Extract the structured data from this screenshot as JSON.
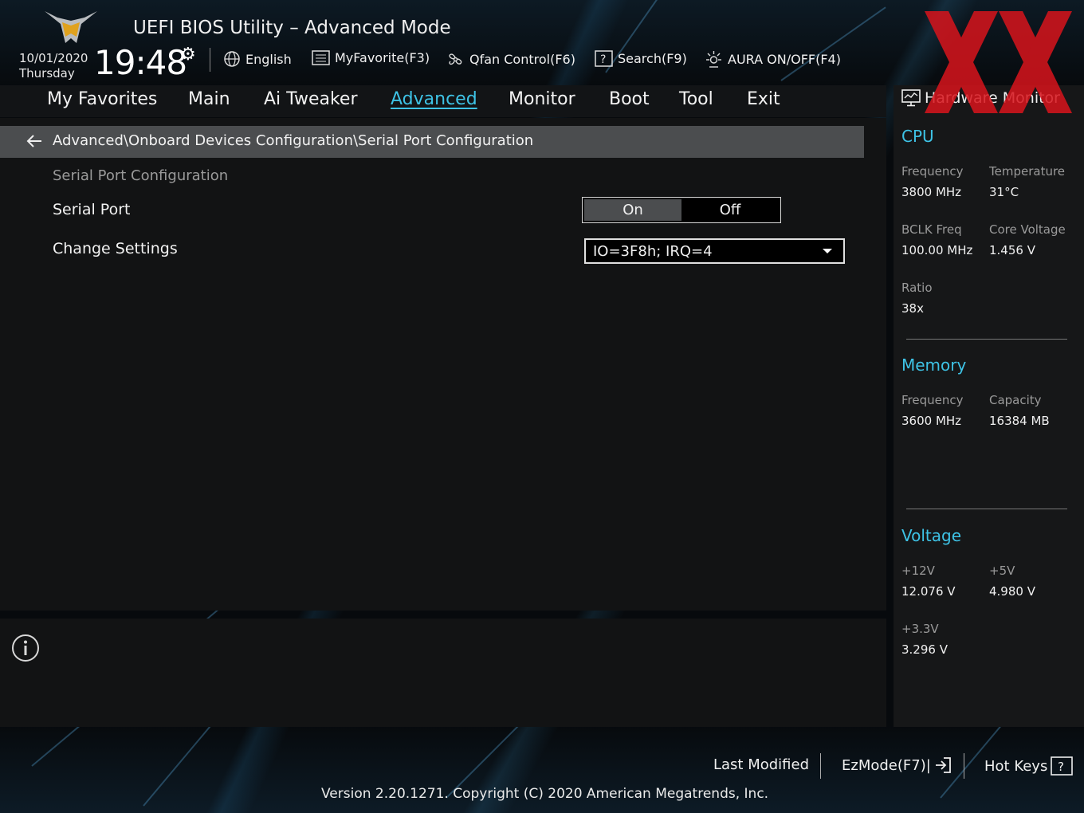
{
  "header": {
    "title": "UEFI BIOS Utility – Advanced Mode",
    "date": "10/01/2020",
    "day": "Thursday",
    "time": "19:48",
    "tools": {
      "language": "English",
      "favorite": "MyFavorite(F3)",
      "qfan": "Qfan Control(F6)",
      "search": "Search(F9)",
      "aura": "AURA ON/OFF(F4)"
    }
  },
  "nav": {
    "favorites": "My Favorites",
    "main": "Main",
    "ai_tweaker": "Ai Tweaker",
    "advanced": "Advanced",
    "monitor": "Monitor",
    "boot": "Boot",
    "tool": "Tool",
    "exit": "Exit",
    "active": "advanced"
  },
  "content": {
    "breadcrumb": "Advanced\\Onboard Devices Configuration\\Serial Port Configuration",
    "section_title": "Serial Port Configuration",
    "serial_port": {
      "label": "Serial Port",
      "on": "On",
      "off": "Off",
      "selected": "On"
    },
    "change_settings": {
      "label": "Change Settings",
      "value": "IO=3F8h; IRQ=4"
    }
  },
  "hardware_monitor": {
    "title": "Hardware Monitor",
    "cpu": {
      "title": "CPU",
      "frequency_label": "Frequency",
      "frequency": "3800 MHz",
      "temperature_label": "Temperature",
      "temperature": "31°C",
      "bclk_label": "BCLK Freq",
      "bclk": "100.00 MHz",
      "core_voltage_label": "Core Voltage",
      "core_voltage": "1.456 V",
      "ratio_label": "Ratio",
      "ratio": "38x"
    },
    "memory": {
      "title": "Memory",
      "frequency_label": "Frequency",
      "frequency": "3600 MHz",
      "capacity_label": "Capacity",
      "capacity": "16384 MB"
    },
    "voltage": {
      "title": "Voltage",
      "v12_label": "+12V",
      "v12": "12.076 V",
      "v5_label": "+5V",
      "v5": "4.980 V",
      "v33_label": "+3.3V",
      "v33": "3.296 V"
    }
  },
  "footer": {
    "last_modified": "Last Modified",
    "ezmode": "EzMode(F7)|",
    "hot_keys": "Hot Keys",
    "version": "Version 2.20.1271. Copyright (C) 2020 American Megatrends, Inc."
  },
  "colors": {
    "accent": "#3ec3e6",
    "watermark": "#d8141c"
  }
}
